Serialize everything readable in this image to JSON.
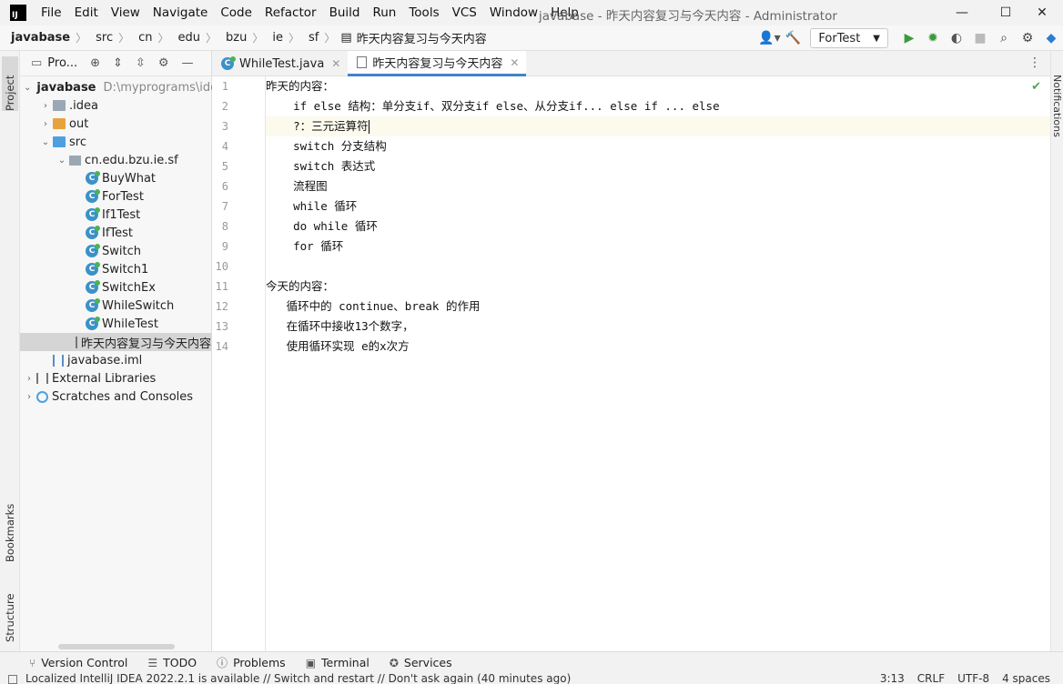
{
  "app": {
    "logo": "IJ",
    "window_title": "javabase - 昨天内容复习与今天内容 - Administrator"
  },
  "menu": [
    "File",
    "Edit",
    "View",
    "Navigate",
    "Code",
    "Refactor",
    "Build",
    "Run",
    "Tools",
    "VCS",
    "Window",
    "Help"
  ],
  "window_controls": {
    "minimize": "—",
    "maximize": "☐",
    "close": "✕"
  },
  "breadcrumb": [
    "javabase",
    "src",
    "cn",
    "edu",
    "bzu",
    "ie",
    "sf",
    "昨天内容复习与今天内容"
  ],
  "toolbar_right": {
    "run_config": "ForTest",
    "icons": [
      "user-icon",
      "build-icon",
      "run-icon",
      "debug-icon",
      "coverage-icon",
      "stop-icon",
      "search-icon",
      "settings-icon",
      "jb-icon"
    ]
  },
  "project_panel": {
    "title": "Pro...",
    "tree": [
      {
        "label": "javabase",
        "hint": "D:\\myprograms\\idea\\j",
        "indent": 0,
        "type": "module",
        "arrow": "⌄"
      },
      {
        "label": ".idea",
        "indent": 1,
        "type": "folder",
        "arrow": "›"
      },
      {
        "label": "out",
        "indent": 1,
        "type": "folder-orange",
        "arrow": "›"
      },
      {
        "label": "src",
        "indent": 1,
        "type": "folder-blue",
        "arrow": "⌄"
      },
      {
        "label": "cn.edu.bzu.ie.sf",
        "indent": 2,
        "type": "package",
        "arrow": "⌄"
      },
      {
        "label": "BuyWhat",
        "indent": 3,
        "type": "class"
      },
      {
        "label": "ForTest",
        "indent": 3,
        "type": "class"
      },
      {
        "label": "If1Test",
        "indent": 3,
        "type": "class"
      },
      {
        "label": "IfTest",
        "indent": 3,
        "type": "class"
      },
      {
        "label": "Switch",
        "indent": 3,
        "type": "class"
      },
      {
        "label": "Switch1",
        "indent": 3,
        "type": "class"
      },
      {
        "label": "SwitchEx",
        "indent": 3,
        "type": "class"
      },
      {
        "label": "WhileSwitch",
        "indent": 3,
        "type": "class"
      },
      {
        "label": "WhileTest",
        "indent": 3,
        "type": "class"
      },
      {
        "label": "昨天内容复习与今天内容",
        "indent": 3,
        "type": "text",
        "selected": true
      },
      {
        "label": "javabase.iml",
        "indent": 1,
        "type": "iml"
      },
      {
        "label": "External Libraries",
        "indent": 0,
        "type": "lib",
        "arrow": "›"
      },
      {
        "label": "Scratches and Consoles",
        "indent": 0,
        "type": "scratch",
        "arrow": "›"
      }
    ]
  },
  "side_tabs": {
    "project": "Project",
    "bookmarks": "Bookmarks",
    "structure": "Structure",
    "notifications": "Notifications"
  },
  "editor": {
    "tabs": [
      {
        "label": "WhileTest.java",
        "active": false
      },
      {
        "label": "昨天内容复习与今天内容",
        "active": true
      }
    ],
    "current_line": 3,
    "lines": [
      "昨天的内容：",
      "    if else 结构：单分支if、双分支if else、从分支if... else if ... else",
      "    ?：三元运算符",
      "    switch 分支结构",
      "    switch 表达式",
      "    流程图",
      "    while 循环",
      "    do while 循环",
      "    for 循环",
      "",
      "今天的内容：",
      "   循环中的 continue、break 的作用",
      "   在循环中接收13个数字，",
      "   使用循环实现 e的x次方"
    ]
  },
  "tool_windows": [
    "Version Control",
    "TODO",
    "Problems",
    "Terminal",
    "Services"
  ],
  "status": {
    "message": "Localized IntelliJ IDEA 2022.2.1 is available // Switch and restart // Don't ask again (40 minutes ago)",
    "position": "3:13",
    "line_sep": "CRLF",
    "encoding": "UTF-8",
    "indent": "4 spaces"
  }
}
